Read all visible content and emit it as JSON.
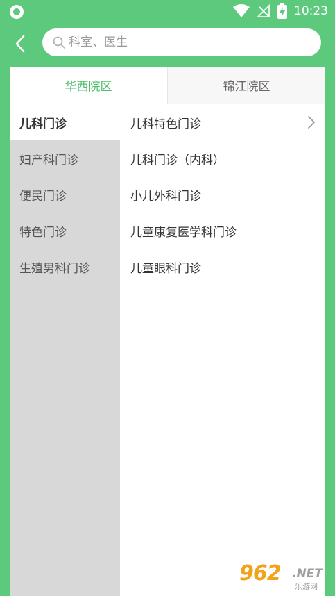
{
  "status_bar": {
    "time": "10:23",
    "icons": [
      "app-icon",
      "wifi-icon",
      "no-signal-icon",
      "battery-charging-icon"
    ]
  },
  "header": {
    "back_icon": "chevron-left-icon",
    "search_icon": "search-icon",
    "search_placeholder": "科室、医生",
    "search_value": ""
  },
  "tabs": [
    {
      "label": "华西院区",
      "active": true
    },
    {
      "label": "锦江院区",
      "active": false
    }
  ],
  "left_menu": [
    {
      "label": "儿科门诊",
      "active": true
    },
    {
      "label": "妇产科门诊",
      "active": false
    },
    {
      "label": "便民门诊",
      "active": false
    },
    {
      "label": "特色门诊",
      "active": false
    },
    {
      "label": "生殖男科门诊",
      "active": false
    }
  ],
  "right_list": [
    {
      "label": "儿科特色门诊",
      "has_chevron": true
    },
    {
      "label": "儿科门诊（内科）",
      "has_chevron": false
    },
    {
      "label": "小儿外科门诊",
      "has_chevron": false
    },
    {
      "label": "儿童康复医学科门诊",
      "has_chevron": false
    },
    {
      "label": "儿童眼科门诊",
      "has_chevron": false
    }
  ],
  "watermark": {
    "logo_text": "962",
    "net_text": ".NET",
    "sub_text": "乐游网"
  },
  "colors": {
    "brand_green": "#5cc97c",
    "active_tab_text": "#4cbf6b",
    "left_menu_bg": "#d8d8d8",
    "watermark_orange": "#f3a21b"
  }
}
